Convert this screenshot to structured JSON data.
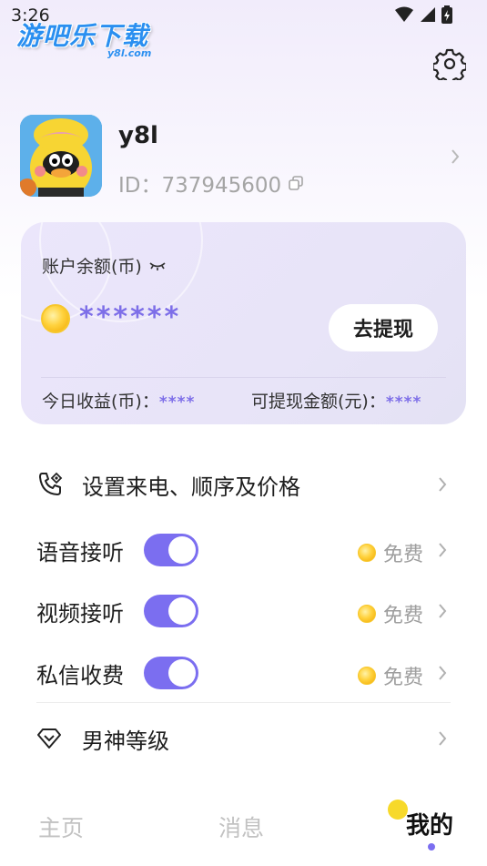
{
  "status_bar": {
    "time": "3:26"
  },
  "watermark": {
    "main": "游吧乐下载",
    "sub": "y8l.com"
  },
  "profile": {
    "name": "y8l",
    "id_label": "ID：737945600"
  },
  "balance": {
    "label": "账户余额(币)",
    "value": "******",
    "withdraw_label": "去提现",
    "today_label": "今日收益(币)：",
    "today_value": "****",
    "withdrawable_label": "可提现金额(元)：",
    "withdrawable_value": "****"
  },
  "menu": {
    "call_settings": "设置来电、顺序及价格",
    "voice": {
      "label": "语音接听",
      "price": "免费"
    },
    "video": {
      "label": "视频接听",
      "price": "免费"
    },
    "message": {
      "label": "私信收费",
      "price": "免费"
    },
    "level": "男神等级"
  },
  "tabs": [
    {
      "label": "主页"
    },
    {
      "label": "消息"
    },
    {
      "label": "我的"
    }
  ],
  "colors": {
    "accent": "#7b6ef0",
    "card": "#ebe6fb",
    "coin": "#ffd23e"
  }
}
